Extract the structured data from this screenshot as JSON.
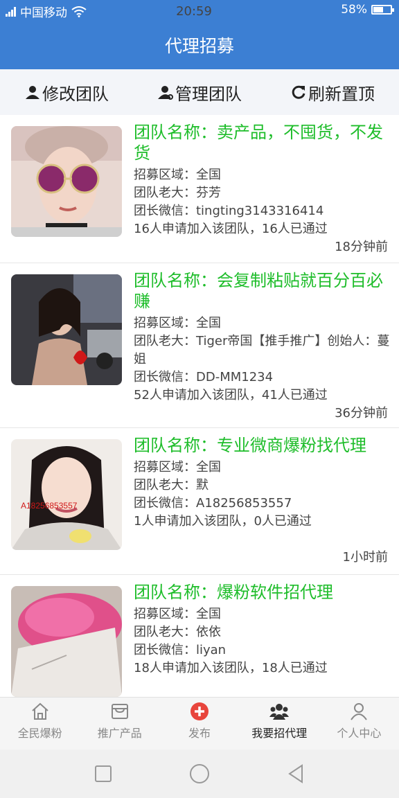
{
  "status_bar": {
    "carrier": "中国移动",
    "time": "20:59",
    "battery_text": "58%",
    "battery_level": 0.58
  },
  "header": {
    "title": "代理招募"
  },
  "toolbar": {
    "edit_team": "修改团队",
    "manage_team": "管理团队",
    "refresh_top": "刷新置顶"
  },
  "teams": [
    {
      "title": "团队名称：卖产品，不囤货，不发货",
      "region": "招募区域：全国",
      "boss": "团队老大：芬芳",
      "wechat": "团长微信：tingting3143316414",
      "stats": "16人申请加入该团队，16人已通过",
      "time": "18分钟前"
    },
    {
      "title": "团队名称：会复制粘贴就百分百必赚",
      "region": "招募区域：全国",
      "boss": "团队老大：Tiger帝国【推手推广】创始人：蔓姐",
      "wechat": "团长微信：DD-MM1234",
      "stats": "52人申请加入该团队，41人已通过",
      "time": "36分钟前"
    },
    {
      "title": "团队名称：专业微商爆粉找代理",
      "region": "招募区域：全国",
      "boss": "团队老大：默",
      "wechat": "团长微信：A18256853557",
      "stats": "1人申请加入该团队，0人已通过",
      "time": "1小时前",
      "photo_watermark": "A18256853557"
    },
    {
      "title": "团队名称：爆粉软件招代理",
      "region": "招募区域：全国",
      "boss": "团队老大：依依",
      "wechat": "团长微信：liyan",
      "stats": "18人申请加入该团队，18人已通过",
      "time": ""
    }
  ],
  "tabbar": {
    "items": [
      {
        "label": "全民爆粉",
        "icon": "home-icon"
      },
      {
        "label": "推广产品",
        "icon": "store-icon"
      },
      {
        "label": "发布",
        "icon": "plus-circle-icon"
      },
      {
        "label": "我要招代理",
        "icon": "group-icon",
        "active": true
      },
      {
        "label": "个人中心",
        "icon": "user-icon"
      }
    ]
  },
  "colors": {
    "primary": "#3c7fd3",
    "title_green": "#1ebd2a",
    "publish_red": "#e8453c"
  }
}
